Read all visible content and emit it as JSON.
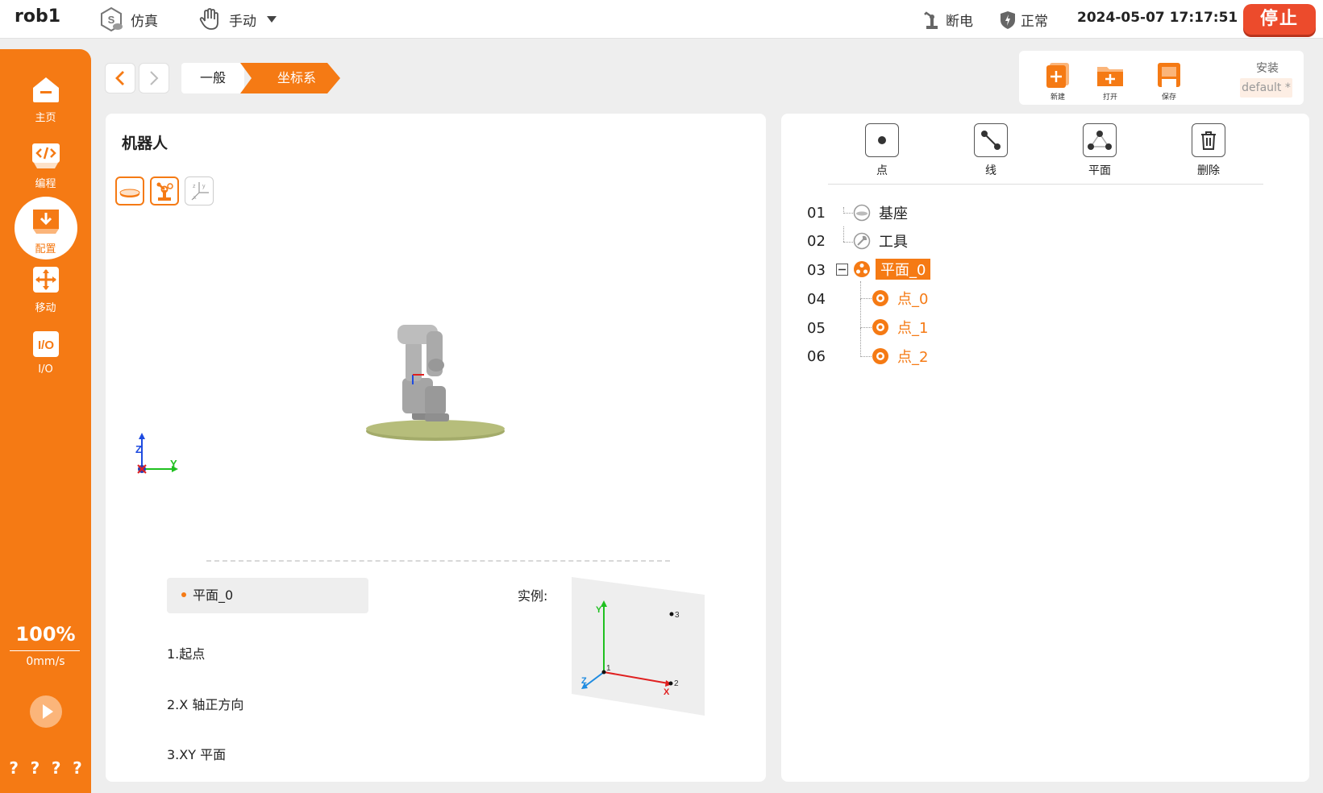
{
  "header": {
    "robot_name": "rob1",
    "sim_label": "仿真",
    "mode_label": "手动",
    "power_label": "断电",
    "state_label": "正常",
    "datetime": "2024-05-07 17:17:51",
    "stop_label": "停止"
  },
  "sidebar": {
    "items": [
      {
        "label": "主页",
        "icon": "home-icon"
      },
      {
        "label": "编程",
        "icon": "code-icon"
      },
      {
        "label": "配置",
        "icon": "config-icon"
      },
      {
        "label": "移动",
        "icon": "move-icon"
      },
      {
        "label": "I/O",
        "icon": "io-icon"
      }
    ],
    "active": "配置",
    "speed_percent": "100%",
    "speed_value": "0mm/s",
    "bottom_marks": [
      "?",
      "?",
      "?",
      "?"
    ]
  },
  "breadcrumb": {
    "items": [
      "一般",
      "坐标系"
    ],
    "active": "坐标系"
  },
  "file_toolbar": {
    "new_label": "新建",
    "open_label": "打开",
    "save_label": "保存",
    "install_label": "安装",
    "install_value": "default *"
  },
  "left_panel": {
    "title": "机器人",
    "view_buttons": [
      "base-view-icon",
      "robot-view-icon",
      "axis-view-icon"
    ],
    "axis_labels": {
      "z": "Z",
      "x": "X",
      "y": "Y"
    },
    "selected_item": "平面_0",
    "steps": [
      "1.起点",
      "2.X 轴正方向",
      "3.XY 平面"
    ],
    "example_label": "实例:",
    "example_axes": {
      "y": "Y",
      "z": "Z",
      "x": "X",
      "p1": "1",
      "p2": "2",
      "p3": "3"
    }
  },
  "right_panel": {
    "tools": [
      {
        "label": "点",
        "icon": "point-icon"
      },
      {
        "label": "线",
        "icon": "line-icon"
      },
      {
        "label": "平面",
        "icon": "plane-icon"
      },
      {
        "label": "删除",
        "icon": "trash-icon"
      }
    ],
    "tree": [
      {
        "num": "01",
        "label": "基座",
        "type": "base",
        "level": 0
      },
      {
        "num": "02",
        "label": "工具",
        "type": "tool",
        "level": 0
      },
      {
        "num": "03",
        "label": "平面_0",
        "type": "plane",
        "level": 0,
        "selected": true
      },
      {
        "num": "04",
        "label": "点_0",
        "type": "point",
        "level": 1
      },
      {
        "num": "05",
        "label": "点_1",
        "type": "point",
        "level": 1
      },
      {
        "num": "06",
        "label": "点_2",
        "type": "point",
        "level": 1
      }
    ]
  },
  "colors": {
    "accent": "#f57a14",
    "stop": "#ec4b2c",
    "axis_x": "#e02020",
    "axis_y": "#20c020",
    "axis_z": "#1e4be0"
  }
}
